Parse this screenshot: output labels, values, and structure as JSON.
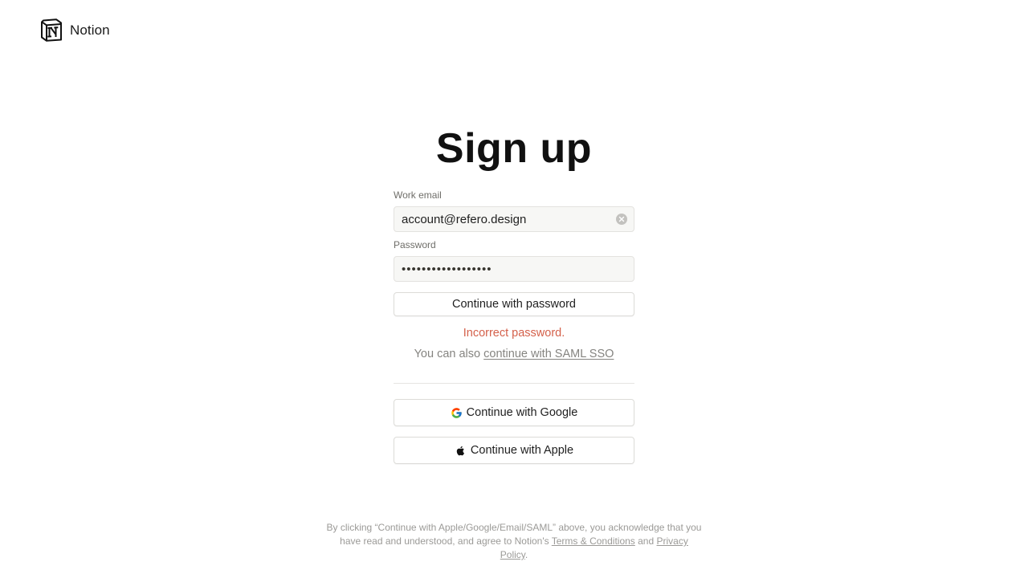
{
  "header": {
    "brand": "Notion",
    "logo_icon": "notion-logo-icon"
  },
  "title": "Sign up",
  "email": {
    "label": "Work email",
    "value": "account@refero.design",
    "clear_icon": "clear-circle-icon"
  },
  "password": {
    "label": "Password",
    "masked_value": "••••••••••••••••••"
  },
  "buttons": {
    "continue_password": "Continue with password",
    "google": "Continue with Google",
    "apple": "Continue with Apple"
  },
  "error": "Incorrect password.",
  "sso": {
    "prefix": "You can also ",
    "link": "continue with SAML SSO"
  },
  "legal": {
    "text_before": "By clicking “Continue with Apple/Google/Email/SAML” above, you acknowledge that you have read and understood, and agree to Notion's ",
    "terms": "Terms & Conditions",
    "and": " and ",
    "privacy": "Privacy Policy",
    "end": "."
  },
  "colors": {
    "error": "#d4614b",
    "field_bg": "#f7f7f5",
    "muted_text": "#858480"
  }
}
